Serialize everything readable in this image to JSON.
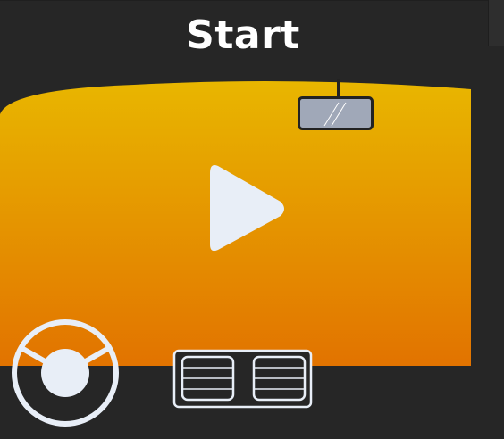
{
  "game": {
    "start_label": "Start"
  },
  "colors": {
    "background": "#262626",
    "windshield_top": "#e8b600",
    "windshield_bottom": "#e27300",
    "icon_fill": "#e8eef7",
    "mirror_fill": "#a0a8b8",
    "outline": "#222222"
  },
  "icons": {
    "play": "play-icon",
    "mirror": "rearview-mirror-icon",
    "steering": "steering-wheel-icon",
    "vents": "dashboard-vents-icon"
  }
}
